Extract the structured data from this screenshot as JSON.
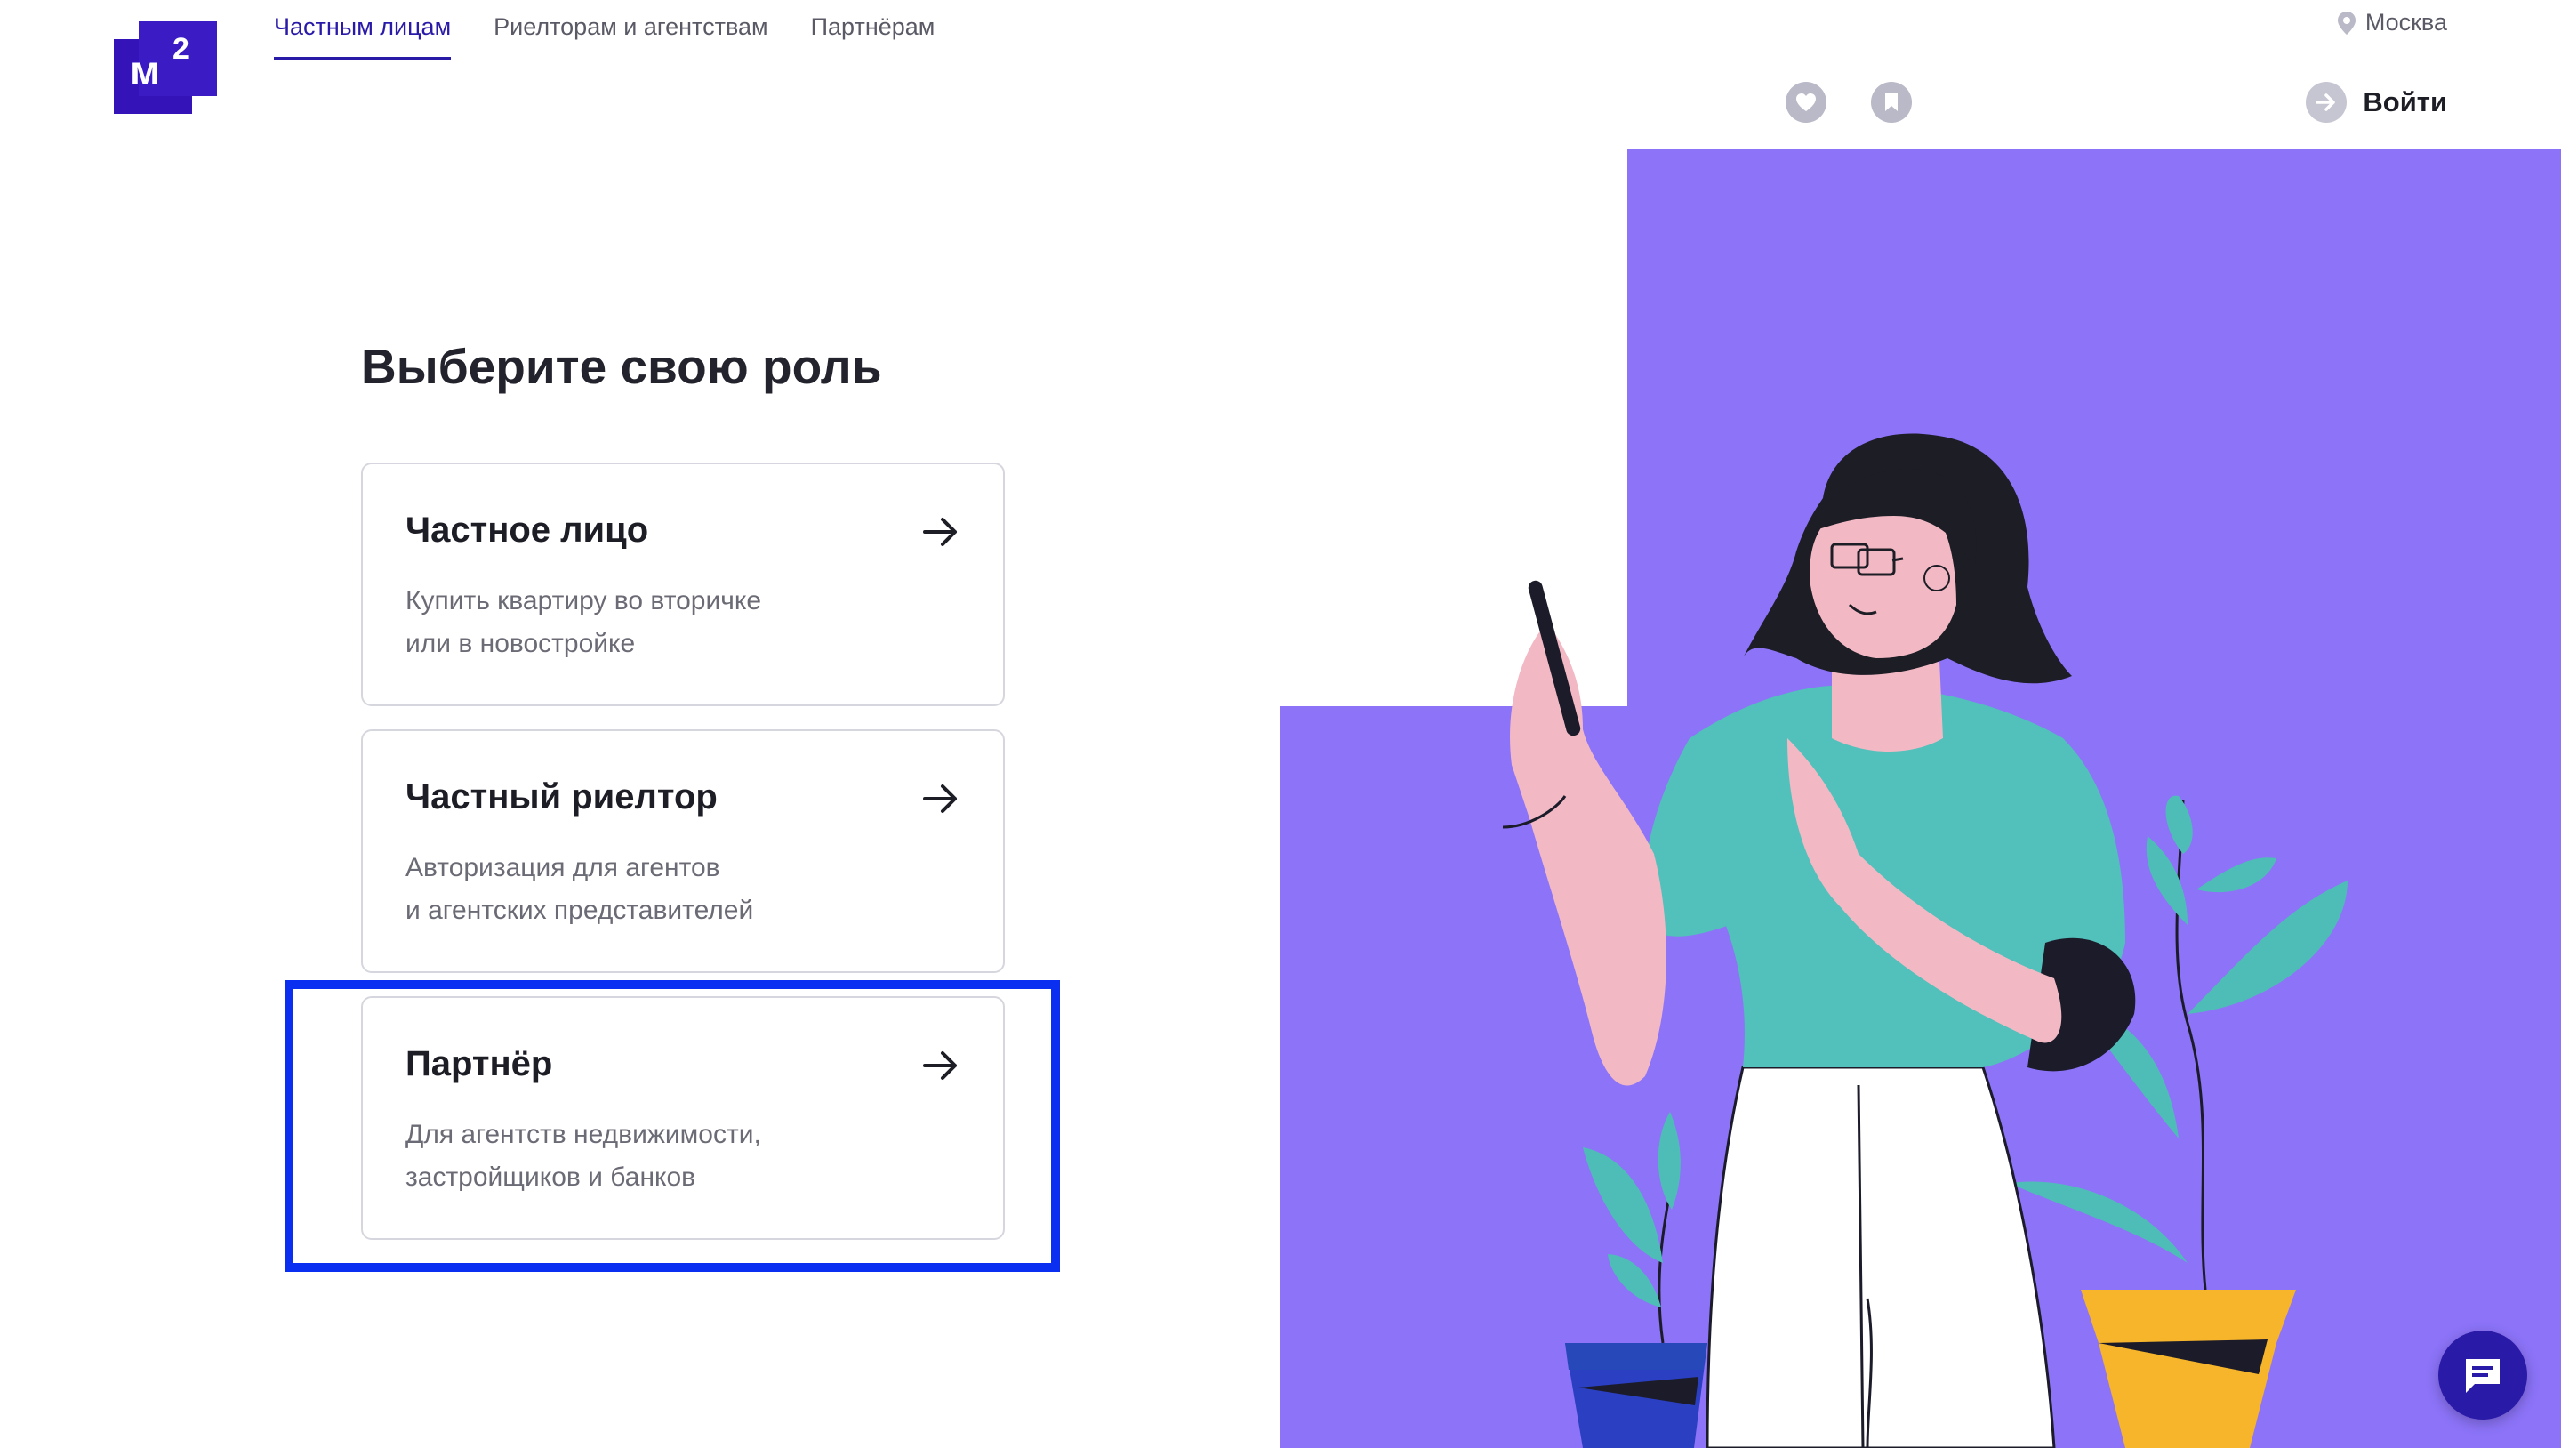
{
  "header": {
    "logo_text": "м",
    "logo_sup": "2",
    "nav": [
      {
        "label": "Частным лицам",
        "active": true
      },
      {
        "label": "Риелторам и агентствам",
        "active": false
      },
      {
        "label": "Партнёрам",
        "active": false
      }
    ],
    "city": "Москва",
    "login_label": "Войти",
    "icons": [
      "heart-icon",
      "bookmark-icon",
      "login-arrow-icon",
      "location-pin-icon"
    ]
  },
  "main": {
    "title": "Выберите свою роль",
    "roles": [
      {
        "title": "Частное лицо",
        "desc_line1": "Купить квартиру во вторичке",
        "desc_line2": "или в новостройке"
      },
      {
        "title": "Частный риелтор",
        "desc_line1": "Авторизация для агентов",
        "desc_line2": "и агентских представителей"
      },
      {
        "title": "Партнёр",
        "desc_line1": "Для агентств недвижимости,",
        "desc_line2": "застройщиков и банков"
      }
    ]
  },
  "colors": {
    "brand": "#3413b9",
    "illustration_bg": "#8b74f9",
    "highlight": "#0b2ff0"
  },
  "chat_icon": "chat-icon"
}
